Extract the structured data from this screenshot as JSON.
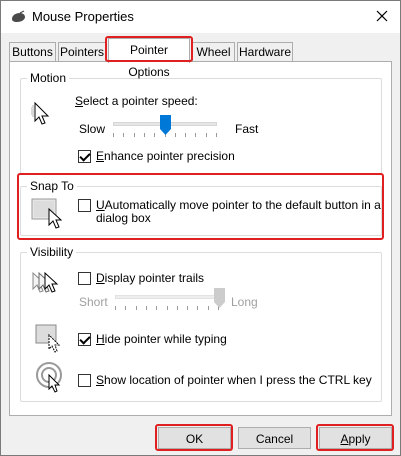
{
  "window": {
    "title": "Mouse Properties"
  },
  "tabs": [
    {
      "label": "Buttons"
    },
    {
      "label": "Pointers"
    },
    {
      "label": "Pointer Options",
      "active": true
    },
    {
      "label": "Wheel"
    },
    {
      "label": "Hardware"
    }
  ],
  "motion": {
    "group_label": "Motion",
    "speed_prefix": "S",
    "speed_rest": "elect a pointer speed:",
    "slow_label": "Slow",
    "fast_label": "Fast",
    "speed_level": 0.5,
    "precision_prefix": "E",
    "precision_rest": "nhance pointer precision",
    "precision_checked": true
  },
  "snap_to": {
    "group_label": "Snap To",
    "option_line1_prefix": "U",
    "option_line1_rest": "Automatically move pointer to the default button in a",
    "option_line2": "dialog box",
    "checked": false
  },
  "visibility": {
    "group_label": "Visibility",
    "trails_prefix": "D",
    "trails_rest": "isplay pointer trails",
    "trails_checked": false,
    "short_label": "Short",
    "long_label": "Long",
    "trail_level": 1.0,
    "hide_prefix": "H",
    "hide_rest": "ide pointer while typing",
    "hide_checked": true,
    "show_prefix": "S",
    "show_rest": "how location of pointer when I press the CTRL key",
    "show_checked": false
  },
  "buttons": {
    "ok": "OK",
    "cancel": "Cancel",
    "apply_prefix": "A",
    "apply_rest": "pply"
  },
  "colors": {
    "highlight": "#e02020",
    "slider_thumb": "#0078d7"
  },
  "icons": {
    "title": "mouse-icon",
    "close": "close-icon",
    "motion": "pointer-speed-icon",
    "snap": "snap-to-button-icon",
    "trails": "pointer-trails-icon",
    "hide": "hide-pointer-icon",
    "show": "show-location-icon"
  }
}
